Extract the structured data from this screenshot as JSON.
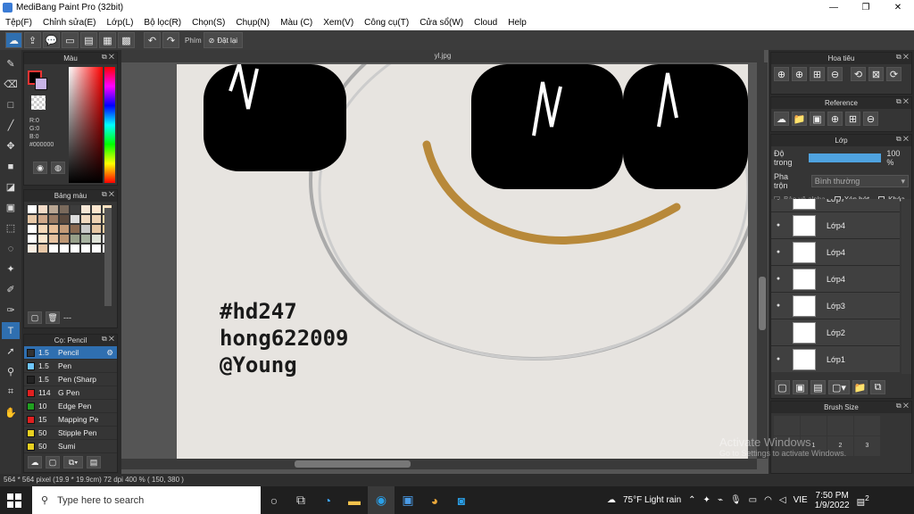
{
  "window": {
    "title": "MediBang Paint Pro (32bit)",
    "minimize": "—",
    "maximize": "❐",
    "close": "✕"
  },
  "menu": [
    "Tệp(F)",
    "Chỉnh sửa(E)",
    "Lớp(L)",
    "Bộ lọc(R)",
    "Chọn(S)",
    "Chụp(N)",
    "Màu (C)",
    "Xem(V)",
    "Công cụ(T)",
    "Cửa sổ(W)",
    "Cloud",
    "Help"
  ],
  "toolbar": {
    "key_label": "Phím",
    "reset_label": "Đặt lại"
  },
  "color_panel": {
    "title": "Màu",
    "r": "R:0",
    "g": "G:0",
    "b": "B:0",
    "hex": "#000000"
  },
  "palette_panel": {
    "title": "Bảng màu",
    "swatches": [
      "#ffffff",
      "#f3dcc8",
      "#b9a693",
      "#7a6a5c",
      "#3d3d3d",
      "#f6e7d6",
      "#fde7cf",
      "#ffe1c0",
      "#e8c9a8",
      "#cfa88a",
      "#9a7b64",
      "#5b4a3e",
      "#ddd",
      "#f0d9c0",
      "#eed3b4",
      "#ffd6a8",
      "#ffffff",
      "#f4d8b9",
      "#e8bf98",
      "#c49b78",
      "#8a6a52",
      "#c9c9c9",
      "#e6c7a4",
      "#f8cda0",
      "#ffffff",
      "#fbe7cf",
      "#e6c2a0",
      "#bc9674",
      "#98a08a",
      "#a8b3a1",
      "#dfe3d8",
      "#ffffff",
      "#fcefe3",
      "#e8c8a8",
      "#ffffff",
      "#ffffff",
      "#ffffff",
      "#ffffff",
      "#ffffff",
      "#ffffff"
    ],
    "count_label": "---"
  },
  "brush_panel": {
    "title": "Cọ: Pencil",
    "brushes": [
      {
        "size": "1.5",
        "name": "Pencil",
        "color": "#333333",
        "selected": true
      },
      {
        "size": "1.5",
        "name": "Pen",
        "color": "#6ec6ff",
        "selected": false
      },
      {
        "size": "1.5",
        "name": "Pen (Sharp",
        "color": "#222222",
        "selected": false
      },
      {
        "size": "114",
        "name": "G Pen",
        "color": "#e02020",
        "selected": false
      },
      {
        "size": "10",
        "name": "Edge Pen",
        "color": "#20a020",
        "selected": false
      },
      {
        "size": "15",
        "name": "Mapping Pe",
        "color": "#e02020",
        "selected": false
      },
      {
        "size": "50",
        "name": "Stipple Pen",
        "color": "#e8d020",
        "selected": false
      },
      {
        "size": "50",
        "name": "Sumi",
        "color": "#e8d020",
        "selected": false
      }
    ]
  },
  "canvas": {
    "tab_title": "yl.jpg",
    "text_lines": [
      "#hd247",
      "hong622009",
      "@Young"
    ]
  },
  "navigator": {
    "title": "Hoa tiêu"
  },
  "reference": {
    "title": "Reference"
  },
  "layers": {
    "title": "Lớp",
    "opacity_label": "Độ trong",
    "opacity_value": "100 %",
    "opacity_fraction": 1.0,
    "blend_label": "Pha trộn",
    "blend_value": "Bình thường",
    "protect_label": "Bảo vệ alpha",
    "clip_label": "Xén bớt",
    "lock_label": "Khóa",
    "items": [
      {
        "name": "Lớp7",
        "visible": true
      },
      {
        "name": "Lớp4",
        "visible": true
      },
      {
        "name": "Lớp4",
        "visible": true
      },
      {
        "name": "Lớp4",
        "visible": true
      },
      {
        "name": "Lớp3",
        "visible": true
      },
      {
        "name": "Lớp2",
        "visible": false
      },
      {
        "name": "Lớp1",
        "visible": true
      }
    ]
  },
  "brush_size": {
    "title": "Brush Size",
    "values": [
      "1",
      "2",
      "3"
    ]
  },
  "status": {
    "text": "564 * 564 pixel   (19.9 * 19.9cm)   72 dpi   400 %   ( 150, 380 )"
  },
  "activation": {
    "line1": "Activate Windows",
    "line2": "Go to Settings to activate Windows."
  },
  "taskbar": {
    "search_placeholder": "Type here to search",
    "weather": "75°F  Light rain",
    "lang": "VIE",
    "time": "7:50 PM",
    "date": "1/9/2022",
    "notif_count": "2"
  }
}
